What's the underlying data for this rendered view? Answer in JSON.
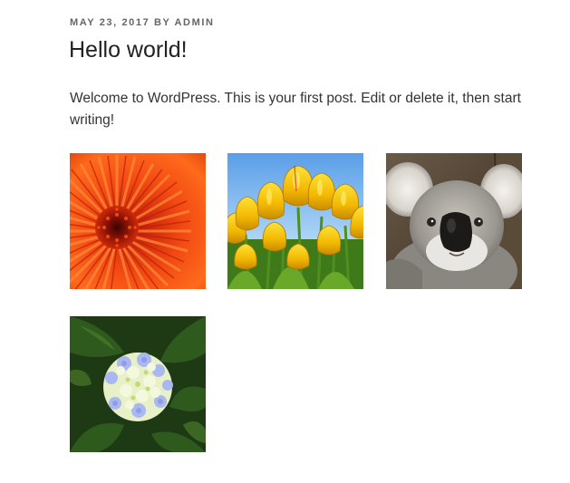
{
  "post": {
    "date": "MAY 23, 2017",
    "by": "BY",
    "author": "ADMIN",
    "title": "Hello world!",
    "content": "Welcome to WordPress. This is your first post. Edit or delete it, then start writing!"
  },
  "gallery": {
    "items": [
      {
        "subject": "red chrysanthemum flower",
        "icon": "chrysanthemum-image"
      },
      {
        "subject": "yellow tulips",
        "icon": "tulips-image"
      },
      {
        "subject": "koala",
        "icon": "koala-image"
      },
      {
        "subject": "hydrangea flower",
        "icon": "hydrangea-image"
      }
    ]
  },
  "colors": {
    "meta_text": "#666666",
    "title_text": "#222222",
    "body_text": "#333333"
  }
}
